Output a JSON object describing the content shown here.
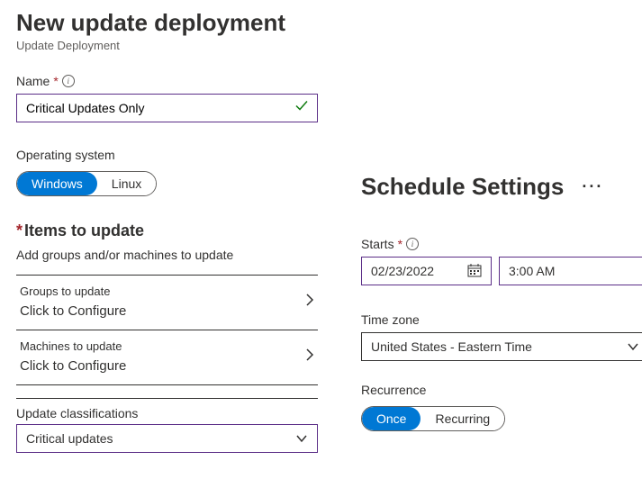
{
  "header": {
    "title": "New update deployment",
    "subtitle": "Update Deployment"
  },
  "name": {
    "label": "Name",
    "value": "Critical Updates Only"
  },
  "os": {
    "label": "Operating system",
    "options": [
      "Windows",
      "Linux"
    ],
    "selected": "Windows"
  },
  "items": {
    "title": "Items to update",
    "subtitle": "Add groups and/or machines to update",
    "groups": {
      "label": "Groups to update",
      "value": "Click to Configure"
    },
    "machines": {
      "label": "Machines to update",
      "value": "Click to Configure"
    }
  },
  "classifications": {
    "label": "Update classifications",
    "value": "Critical updates"
  },
  "schedule": {
    "title": "Schedule Settings",
    "starts": {
      "label": "Starts",
      "date": "02/23/2022",
      "time": "3:00 AM"
    },
    "timezone": {
      "label": "Time zone",
      "value": "United States - Eastern Time"
    },
    "recurrence": {
      "label": "Recurrence",
      "options": [
        "Once",
        "Recurring"
      ],
      "selected": "Once"
    }
  }
}
